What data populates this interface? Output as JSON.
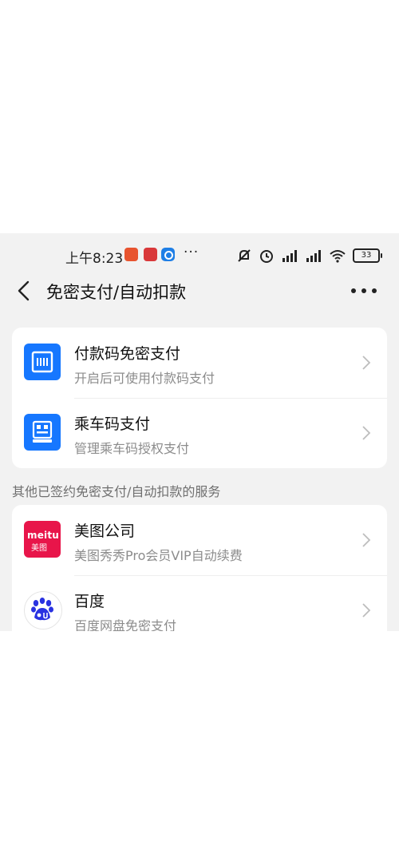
{
  "status_bar": {
    "time": "上午8:23",
    "more": "···",
    "battery": "33"
  },
  "header": {
    "title": "免密支付/自动扣款"
  },
  "primary_services": [
    {
      "title": "付款码免密支付",
      "subtitle": "开启后可使用付款码支付",
      "icon": "payment-code-icon"
    },
    {
      "title": "乘车码支付",
      "subtitle": "管理乘车码授权支付",
      "icon": "transit-code-icon"
    }
  ],
  "section_label": "其他已签约免密支付/自动扣款的服务",
  "other_services": [
    {
      "title": "美图公司",
      "subtitle": "美图秀秀Pro会员VIP自动续费",
      "icon": "meitu-logo",
      "logo_text": "meitu",
      "logo_sub": "美图"
    },
    {
      "title": "百度",
      "subtitle": "百度网盘免密支付",
      "icon": "baidu-logo"
    }
  ],
  "colors": {
    "accent": "#1677ff",
    "meitu": "#e8154a",
    "baidu": "#2932e1"
  }
}
